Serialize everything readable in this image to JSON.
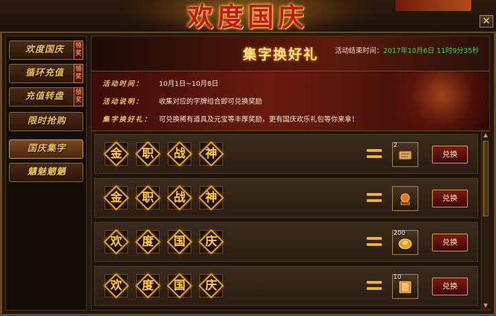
{
  "banner": {
    "title": "欢度国庆"
  },
  "sidebar": {
    "items": [
      {
        "label": "欢度国庆",
        "badge": "领奖"
      },
      {
        "label": "循环充值",
        "badge": "领奖"
      },
      {
        "label": "充值转盘",
        "badge": "领奖"
      },
      {
        "label": "限时抢购",
        "badge": ""
      },
      {
        "label": "国庆集字",
        "badge": ""
      },
      {
        "label": "魑魅魍魉",
        "badge": ""
      }
    ],
    "active_index": 4
  },
  "header": {
    "title": "集字换好礼",
    "end_time_label": "活动结束时间：",
    "end_time_value": "2017年10月6日 11时9分35秒"
  },
  "info": {
    "time_key": "活动时间：",
    "time_val": "10月1日~10月8日",
    "desc_key": "活动说明：",
    "desc_val": "收集对应的字牌组合即可兑换奖励",
    "reward_key": "集字换好礼：",
    "reward_val": "可兑换稀有道具及元宝等丰厚奖励，更有国庆欢乐礼包等你来拿！"
  },
  "rows": [
    {
      "chars": [
        "金",
        "职",
        "战",
        "神"
      ],
      "reward_qty": "2",
      "reward_icon": "scroll-icon",
      "button": "兑换"
    },
    {
      "chars": [
        "金",
        "职",
        "战",
        "神"
      ],
      "reward_qty": "",
      "reward_icon": "orb-icon",
      "button": "兑换"
    },
    {
      "chars": [
        "欢",
        "度",
        "国",
        "庆"
      ],
      "reward_qty": "200",
      "reward_icon": "gold-ingot-icon",
      "button": "兑换"
    },
    {
      "chars": [
        "欢",
        "度",
        "国",
        "庆"
      ],
      "reward_qty": "10",
      "reward_icon": "book-icon",
      "button": "兑换"
    }
  ],
  "colors": {
    "accent_gold": "#f2c25a",
    "time_green": "#38d84a",
    "button_red": "#7a1a10"
  }
}
